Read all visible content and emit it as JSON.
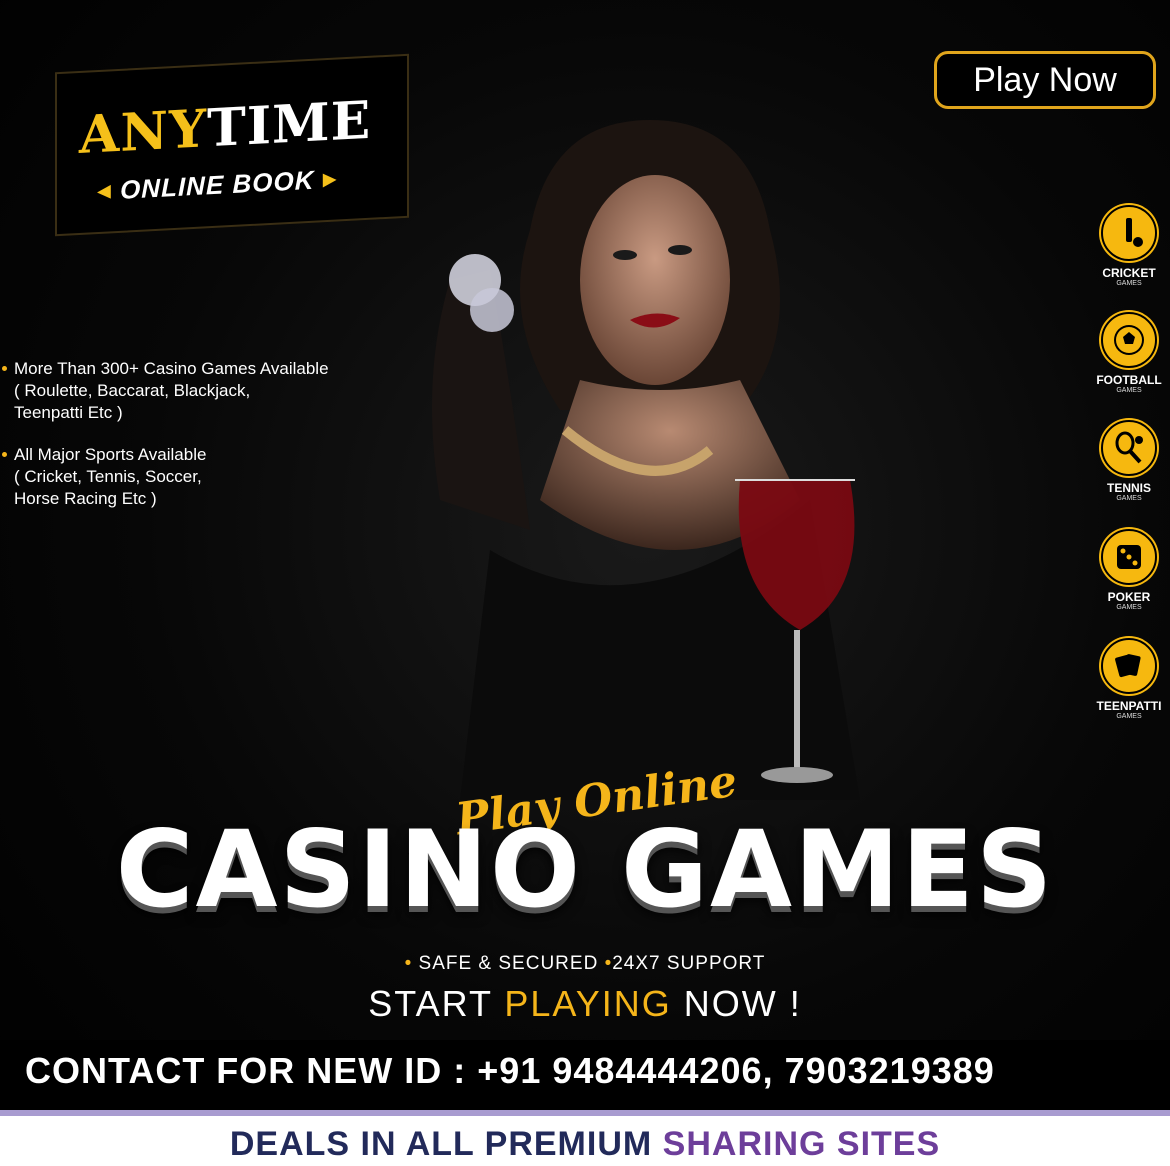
{
  "header": {
    "logo": {
      "word1": "ANY",
      "word2": "TIME",
      "subtitle": "ONLINE BOOK"
    },
    "play_button": "Play Now"
  },
  "features": [
    {
      "line1": "More Than 300+ Casino Games Available",
      "line2": "( Roulette, Baccarat, Blackjack,",
      "line3": "Teenpatti Etc )"
    },
    {
      "line1": "All Major Sports Available",
      "line2": "( Cricket, Tennis, Soccer,",
      "line3": "Horse Racing Etc )"
    }
  ],
  "sports": [
    {
      "label": "CRICKET",
      "sub": "GAMES",
      "icon": "cricket-icon"
    },
    {
      "label": "FOOTBALL",
      "sub": "GAMES",
      "icon": "football-icon"
    },
    {
      "label": "TENNIS",
      "sub": "GAMES",
      "icon": "tennis-icon"
    },
    {
      "label": "POKER",
      "sub": "GAMES",
      "icon": "dice-icon"
    },
    {
      "label": "TEENPATTI",
      "sub": "GAMES",
      "icon": "cards-icon"
    }
  ],
  "headline": {
    "script": "Play Online",
    "title": "CASINO GAMES",
    "badge1": "SAFE & SECURED",
    "badge2": "24X7 SUPPORT",
    "cta_start": "START",
    "cta_playing": "PLAYING",
    "cta_end": "NOW !"
  },
  "contact": {
    "text": "CONTACT FOR NEW ID : +91 9484444206, 7903219389"
  },
  "deals": {
    "part1": "DEALS IN ALL PREMIUM",
    "part2": "SHARING SITES"
  },
  "colors": {
    "gold": "#f5b51a",
    "purple": "#6d3e9a",
    "navy": "#222a5a",
    "background": "#000000"
  }
}
